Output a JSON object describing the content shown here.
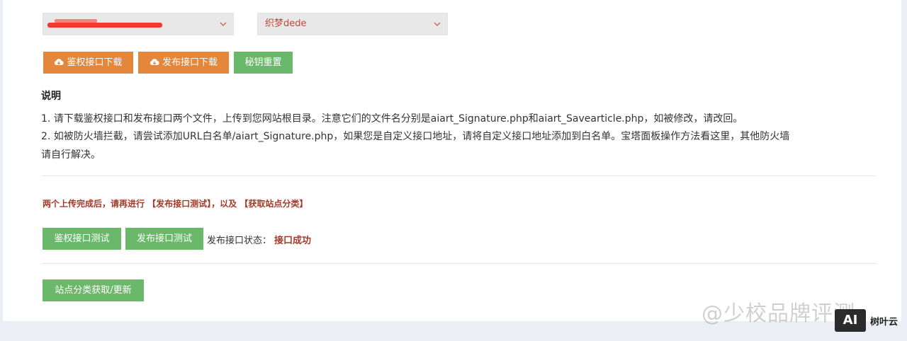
{
  "form": {
    "site_select": {
      "value": ""
    },
    "cms_select": {
      "value": "织梦dede"
    }
  },
  "toolbar": {
    "auth_download_label": "鉴权接口下载",
    "publish_download_label": "发布接口下载",
    "reset_key_label": "秘钥重置"
  },
  "instructions": {
    "title": "说明",
    "line1": "1. 请下载鉴权接口和发布接口两个文件，上传到您网站根目录。注意它们的文件名分别是aiart_Signature.php和aiart_Savearticle.php，如被修改，请改回。",
    "line2a": "2. 如被防火墙拦截，请尝试添加URL白名单/aiart_Signature.php，如果您是自定义接口地址，请将自定义接口地址添加到白名单。宝塔面板操作方法看这里，其他防火墙",
    "line2b": "请自行解决。"
  },
  "test": {
    "notice": "两个上传完成后，请再进行 【发布接口测试】，以及 【获取站点分类】",
    "auth_test_label": "鉴权接口测试",
    "publish_test_label": "发布接口测试",
    "status_label": "发布接口状态：",
    "status_value": "接口成功"
  },
  "category": {
    "fetch_label": "站点分类获取/更新"
  },
  "watermark": {
    "text": "@少校品牌评测",
    "logo": "AI",
    "brand": "树叶云"
  },
  "colors": {
    "orange_button": "#e4873b",
    "green_button": "#6ab86a",
    "alert_text": "#a33a2a"
  }
}
